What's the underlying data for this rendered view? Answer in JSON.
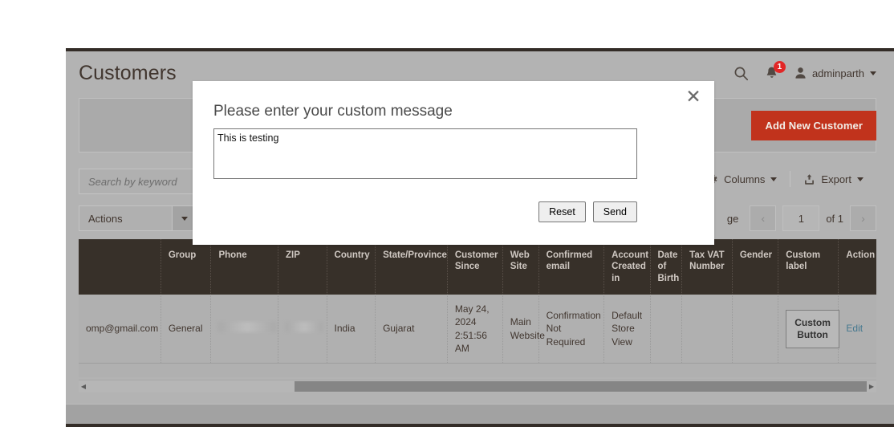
{
  "header": {
    "title": "Customers",
    "search_icon": "search-icon",
    "bell_icon": "bell-icon",
    "notification_count": "1",
    "user_icon": "user-icon",
    "admin_name": "adminparth",
    "caret_icon": "chevron-down-icon"
  },
  "actions": {
    "add_new_customer": "Add New Customer"
  },
  "toolbar": {
    "search_placeholder": "Search by keyword",
    "search_value": "",
    "columns_label": "Columns",
    "columns_icon": "gear-icon",
    "export_label": "Export",
    "export_icon": "export-upload-icon",
    "caret_icon": "chevron-down-icon"
  },
  "actions_row": {
    "actions_label": "Actions",
    "actions_caret": "chevron-down-icon",
    "per_page_label_visible": "ge",
    "prev_icon": "chevron-left-icon",
    "next_icon": "chevron-right-icon",
    "page_number": "1",
    "page_of": "of 1"
  },
  "grid": {
    "columns": [
      "",
      "Group",
      "Phone",
      "ZIP",
      "Country",
      "State/Province",
      "Customer Since",
      "Web Site",
      "Confirmed email",
      "Account Created in",
      "Date of Birth",
      "Tax VAT Number",
      "Gender",
      "Custom label",
      "Action"
    ],
    "rows": [
      {
        "email": "omp@gmail.com",
        "group": "General",
        "phone": "",
        "zip": "",
        "country": "India",
        "state": "Gujarat",
        "customer_since": "May 24, 2024 2:51:56 AM",
        "web_site": "Main Website",
        "confirmed_email": "Confirmation Not Required",
        "account_created_in": "Default Store View",
        "dob": "",
        "tax_vat": "",
        "gender": "",
        "custom_label": "Custom Button",
        "action": "Edit"
      }
    ]
  },
  "scrollbar": {
    "left_arrow": "triangle-left-icon",
    "right_arrow": "triangle-right-icon"
  },
  "modal": {
    "title": "Please enter your custom message",
    "close_icon": "close-icon",
    "textarea_value": "This is testing",
    "textarea_placeholder": "",
    "reset_label": "Reset",
    "send_label": "Send"
  },
  "colors": {
    "brand_red": "#c1331c",
    "grid_header_dark": "#373029",
    "link_blue": "#45788f",
    "badge_red": "#e22626"
  }
}
